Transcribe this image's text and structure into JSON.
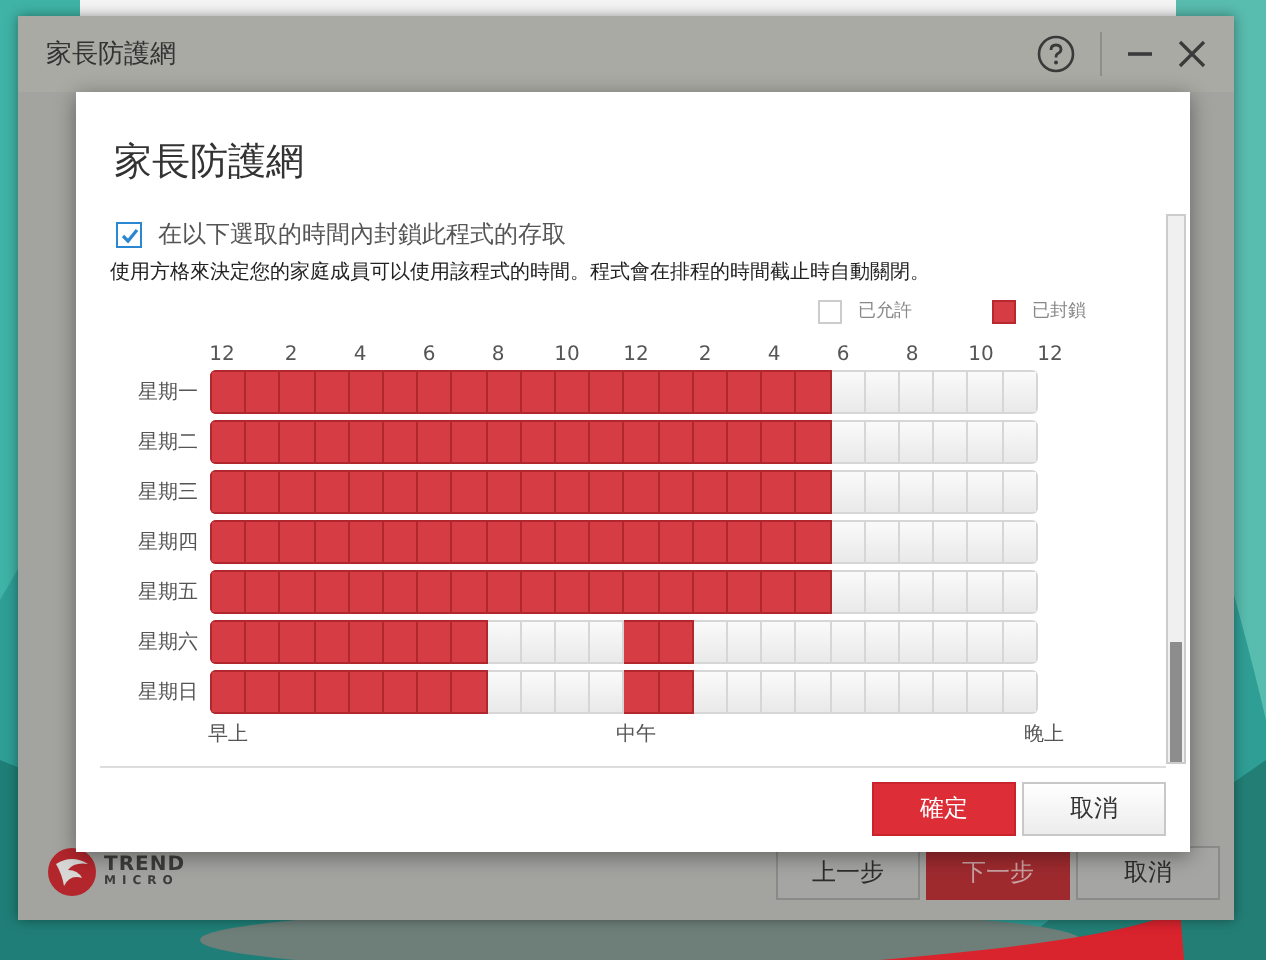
{
  "window": {
    "title": "家長防護網"
  },
  "dialog": {
    "title": "家長防護網",
    "block_option": {
      "label": "在以下選取的時間內封鎖此程式的存取",
      "checked": true
    },
    "description": "使用方格來決定您的家庭成員可以使用該程式的時間。程式會在排程的時間截止時自動關閉。",
    "legend": [
      {
        "label": "已允許",
        "kind": "allowed"
      },
      {
        "label": "已封鎖",
        "kind": "blocked"
      }
    ],
    "hour_labels": [
      "12",
      "2",
      "4",
      "6",
      "8",
      "10",
      "12",
      "2",
      "4",
      "6",
      "8",
      "10",
      "12"
    ],
    "days": [
      {
        "label": "星期一",
        "blocked": [
          true,
          true,
          true,
          true,
          true,
          true,
          true,
          true,
          true,
          true,
          true,
          true,
          true,
          true,
          true,
          true,
          true,
          true,
          false,
          false,
          false,
          false,
          false,
          false
        ]
      },
      {
        "label": "星期二",
        "blocked": [
          true,
          true,
          true,
          true,
          true,
          true,
          true,
          true,
          true,
          true,
          true,
          true,
          true,
          true,
          true,
          true,
          true,
          true,
          false,
          false,
          false,
          false,
          false,
          false
        ]
      },
      {
        "label": "星期三",
        "blocked": [
          true,
          true,
          true,
          true,
          true,
          true,
          true,
          true,
          true,
          true,
          true,
          true,
          true,
          true,
          true,
          true,
          true,
          true,
          false,
          false,
          false,
          false,
          false,
          false
        ]
      },
      {
        "label": "星期四",
        "blocked": [
          true,
          true,
          true,
          true,
          true,
          true,
          true,
          true,
          true,
          true,
          true,
          true,
          true,
          true,
          true,
          true,
          true,
          true,
          false,
          false,
          false,
          false,
          false,
          false
        ]
      },
      {
        "label": "星期五",
        "blocked": [
          true,
          true,
          true,
          true,
          true,
          true,
          true,
          true,
          true,
          true,
          true,
          true,
          true,
          true,
          true,
          true,
          true,
          true,
          false,
          false,
          false,
          false,
          false,
          false
        ]
      },
      {
        "label": "星期六",
        "blocked": [
          true,
          true,
          true,
          true,
          true,
          true,
          true,
          true,
          false,
          false,
          false,
          false,
          true,
          true,
          false,
          false,
          false,
          false,
          false,
          false,
          false,
          false,
          false,
          false
        ]
      },
      {
        "label": "星期日",
        "blocked": [
          true,
          true,
          true,
          true,
          true,
          true,
          true,
          true,
          false,
          false,
          false,
          false,
          true,
          true,
          false,
          false,
          false,
          false,
          false,
          false,
          false,
          false,
          false,
          false
        ]
      }
    ],
    "period_labels": [
      "早上",
      "中午",
      "晚上"
    ],
    "buttons": [
      {
        "label": "確定",
        "kind": "primary"
      },
      {
        "label": "取消",
        "kind": "secondary"
      }
    ]
  },
  "logo": {
    "name": "TREND",
    "sub": "MICRO"
  },
  "footer_buttons": [
    {
      "label": "上一步",
      "kind": "secondary"
    },
    {
      "label": "下一步",
      "kind": "primary"
    },
    {
      "label": "取消",
      "kind": "secondary"
    }
  ]
}
